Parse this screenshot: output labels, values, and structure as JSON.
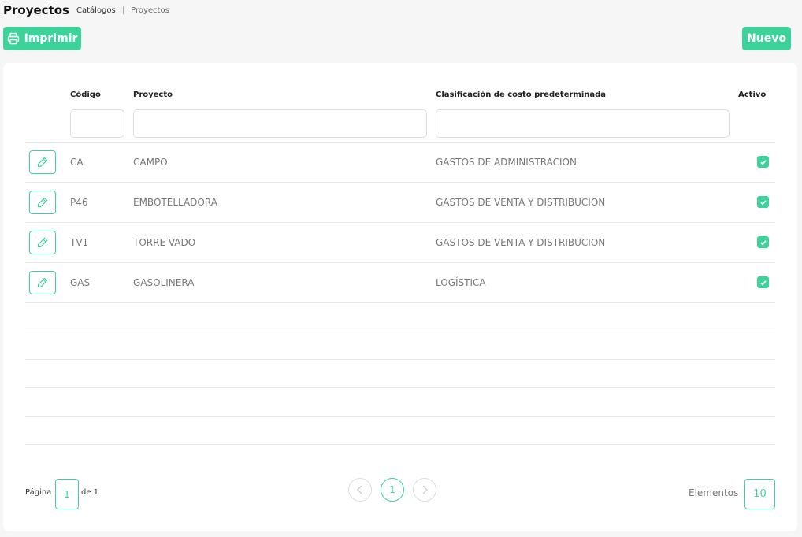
{
  "page": {
    "title": "Proyectos",
    "breadcrumb": [
      "Catálogos",
      "Proyectos"
    ],
    "breadcrumb_separator": "|"
  },
  "toolbar": {
    "print_label": "Imprimir",
    "new_label": "Nuevo",
    "accent_color": "#3ed29b"
  },
  "table": {
    "headers": {
      "codigo": "Código",
      "proyecto": "Proyecto",
      "clasificacion": "Clasificación de costo predeterminada",
      "activo": "Activo"
    },
    "rows": [
      {
        "codigo": "CA",
        "proyecto": "CAMPO",
        "clasificacion": "GASTOS DE ADMINISTRACION",
        "activo": true
      },
      {
        "codigo": "P46",
        "proyecto": "EMBOTELLADORA",
        "clasificacion": "GASTOS DE VENTA Y DISTRIBUCION",
        "activo": true
      },
      {
        "codigo": "TV1",
        "proyecto": "TORRE VADO",
        "clasificacion": "GASTOS DE VENTA Y DISTRIBUCION",
        "activo": true
      },
      {
        "codigo": "GAS",
        "proyecto": "GASOLINERA",
        "clasificacion": "LOGÍSTICA",
        "activo": true
      }
    ]
  },
  "pagination": {
    "page_label": "Página",
    "current_page": "1",
    "of_label": "de 1",
    "active_page": "1",
    "elements_label": "Elementos",
    "page_size": "10"
  }
}
